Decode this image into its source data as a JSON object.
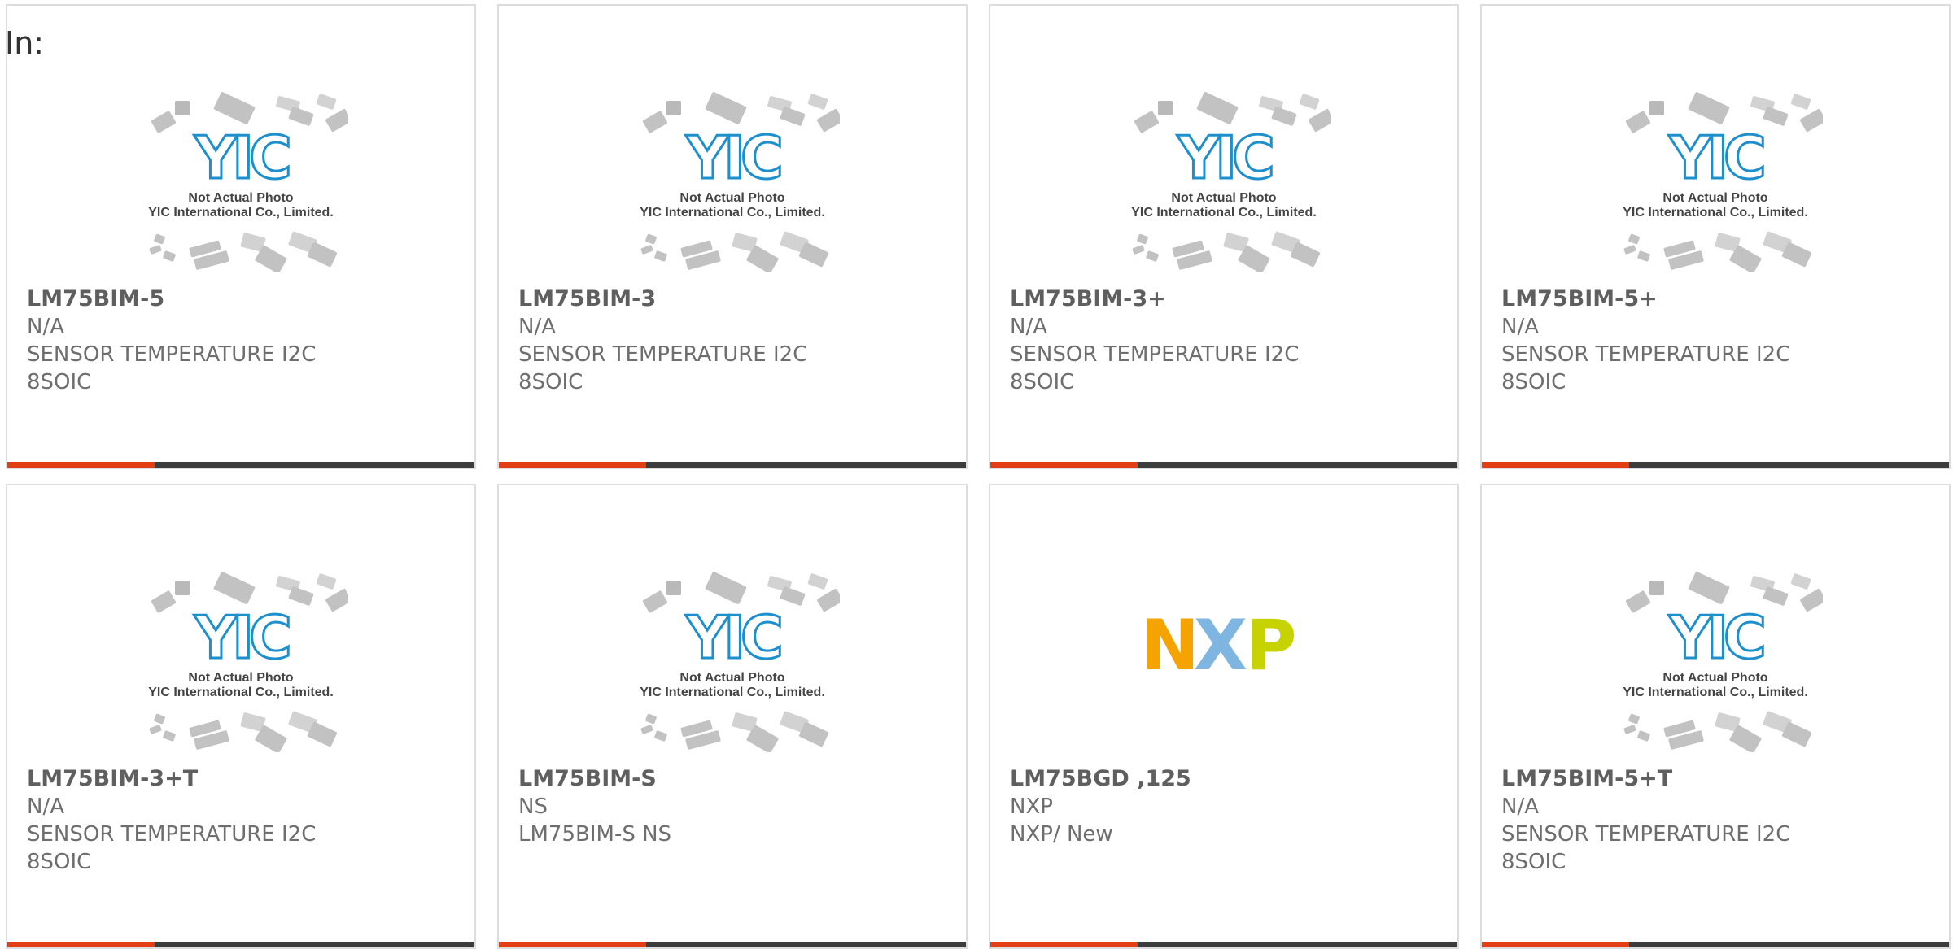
{
  "page": {
    "prefix_label": "In:"
  },
  "colors": {
    "accent": "#e43e17",
    "bar": "#3c3c3c",
    "title_text": "#5f5f5f",
    "body_text": "#6e6e6e",
    "yic_blue": "#1c8fcc"
  },
  "placeholder": {
    "line1": "Not Actual Photo",
    "line2": "YIC International Co., Limited.",
    "logo_text": "YIC"
  },
  "nxp_logo": {
    "letters": [
      "N",
      "X",
      "P"
    ],
    "colors": [
      "#f5a300",
      "#7fb6e1",
      "#c6d300"
    ]
  },
  "products": [
    {
      "name": "LM75BIM-5",
      "lines": [
        "N/A",
        "SENSOR TEMPERATURE I2C",
        "8SOIC"
      ],
      "image": "yic-placeholder"
    },
    {
      "name": "LM75BIM-3",
      "lines": [
        "N/A",
        "SENSOR TEMPERATURE I2C",
        "8SOIC"
      ],
      "image": "yic-placeholder"
    },
    {
      "name": "LM75BIM-3+",
      "lines": [
        "N/A",
        "SENSOR TEMPERATURE I2C",
        "8SOIC"
      ],
      "image": "yic-placeholder"
    },
    {
      "name": "LM75BIM-5+",
      "lines": [
        "N/A",
        "SENSOR TEMPERATURE I2C",
        "8SOIC"
      ],
      "image": "yic-placeholder"
    },
    {
      "name": "LM75BIM-3+T",
      "lines": [
        "N/A",
        "SENSOR TEMPERATURE I2C",
        "8SOIC"
      ],
      "image": "yic-placeholder"
    },
    {
      "name": "LM75BIM-S",
      "lines": [
        "NS",
        "LM75BIM-S NS"
      ],
      "image": "yic-placeholder"
    },
    {
      "name": "LM75BGD ,125",
      "lines": [
        "NXP",
        "NXP/ New"
      ],
      "image": "nxp-logo"
    },
    {
      "name": "LM75BIM-5+T",
      "lines": [
        "N/A",
        "SENSOR TEMPERATURE I2C",
        "8SOIC"
      ],
      "image": "yic-placeholder"
    }
  ]
}
